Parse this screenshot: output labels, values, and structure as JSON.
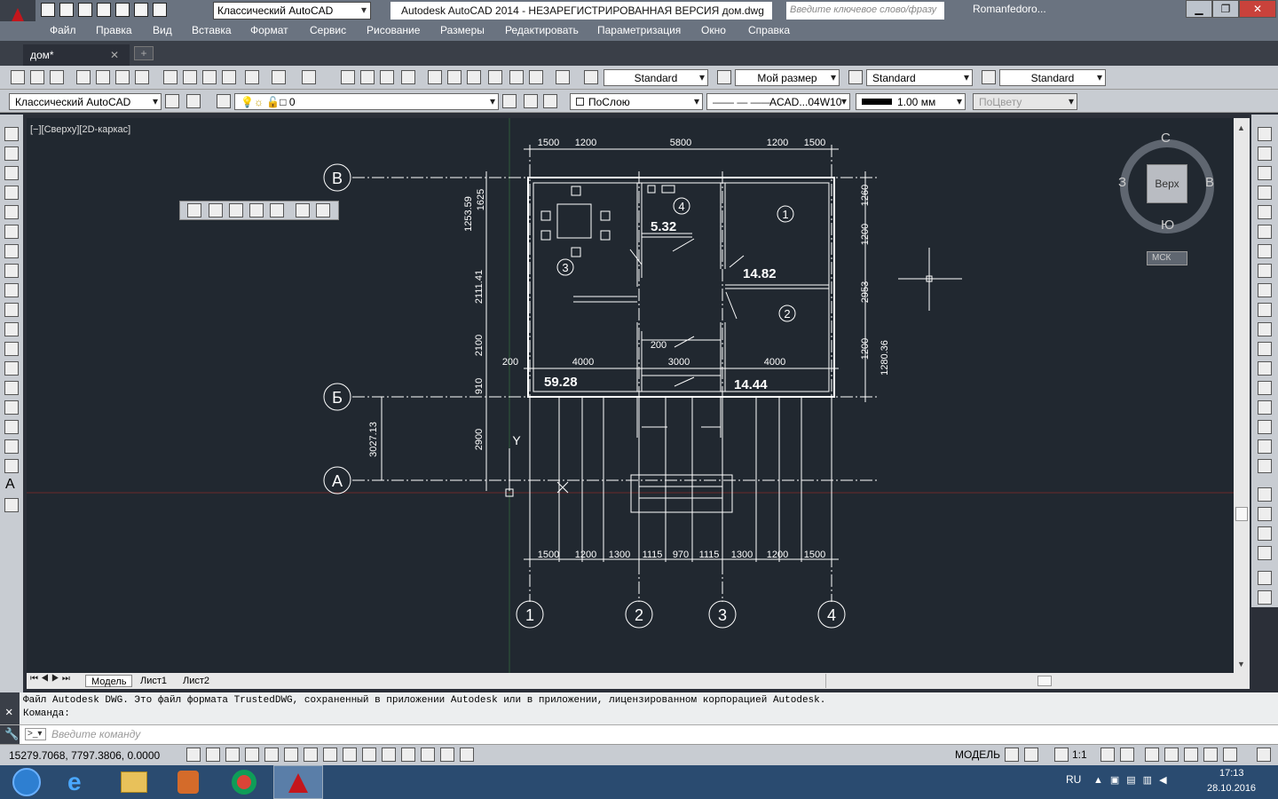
{
  "titlebar": {
    "workspace": "Классический AutoCAD",
    "title": "Autodesk AutoCAD 2014 - НЕЗАРЕГИСТРИРОВАННАЯ ВЕРСИЯ   дом.dwg",
    "search_placeholder": "Введите ключевое слово/фразу",
    "user": "Romanfedoro..."
  },
  "menu": [
    "Файл",
    "Правка",
    "Вид",
    "Вставка",
    "Формат",
    "Сервис",
    "Рисование",
    "Размеры",
    "Редактировать",
    "Параметризация",
    "Окно",
    "Справка"
  ],
  "doc_tab": "дом*",
  "toolbar1": {
    "textstyle": "Standard",
    "dimstyle": "Мой размер",
    "tablestyle": "Standard",
    "mleaderstyle": "Standard"
  },
  "toolbar2": {
    "workspace": "Классический AutoCAD",
    "layer": "0",
    "color": "ПоСлою",
    "linetype": "ACAD...04W10",
    "lineweight": "1.00 мм",
    "plotstyle": "ПоЦвету"
  },
  "viewport_label": "[−][Сверху][2D-каркас]",
  "viewcube": {
    "n": "С",
    "s": "Ю",
    "w": "З",
    "e": "В",
    "face": "Верх",
    "ucs": "МСК"
  },
  "drawing": {
    "axes_rows": [
      "В",
      "Б",
      "А"
    ],
    "axes_cols": [
      "1",
      "2",
      "3",
      "4"
    ],
    "dims_top": [
      "1500",
      "1200",
      "5800",
      "1200",
      "1500"
    ],
    "dims_bottom": [
      "1500",
      "1200",
      "1300",
      "1115",
      "970",
      "1115",
      "1300",
      "1200",
      "1500"
    ],
    "dims_mid": [
      "200",
      "4000",
      "3000",
      "4000"
    ],
    "dims_left": [
      "1253.59",
      "1625",
      "2111.41",
      "2100",
      "910",
      "2900",
      "3027.13"
    ],
    "dims_right": [
      "1260",
      "1200",
      "2953",
      "1200",
      "1280.36"
    ],
    "small_dim": "200",
    "room_numbers": [
      "1",
      "2",
      "3",
      "4"
    ],
    "areas": [
      "5.32",
      "14.82",
      "59.28",
      "14.44"
    ],
    "y_label": "Y"
  },
  "layout_tabs": [
    "Модель",
    "Лист1",
    "Лист2"
  ],
  "command": {
    "history": "Файл Autodesk DWG. Это файл формата TrustedDWG, сохраненный в приложении Autodesk или в приложении, лицензированном корпорацией Autodesk.",
    "prompt": "Команда:",
    "placeholder": "Введите команду"
  },
  "status": {
    "coords": "15279.7068, 7797.3806, 0.0000",
    "model": "МОДЕЛЬ",
    "scale": "1:1"
  },
  "tray": {
    "lang": "RU",
    "time": "17:13",
    "date": "28.10.2016"
  },
  "colors": {
    "canvas": "#212830",
    "grid_green": "#2e5a3a",
    "grid_red": "#6a2a2a",
    "drawing_line": "#ffffff"
  }
}
